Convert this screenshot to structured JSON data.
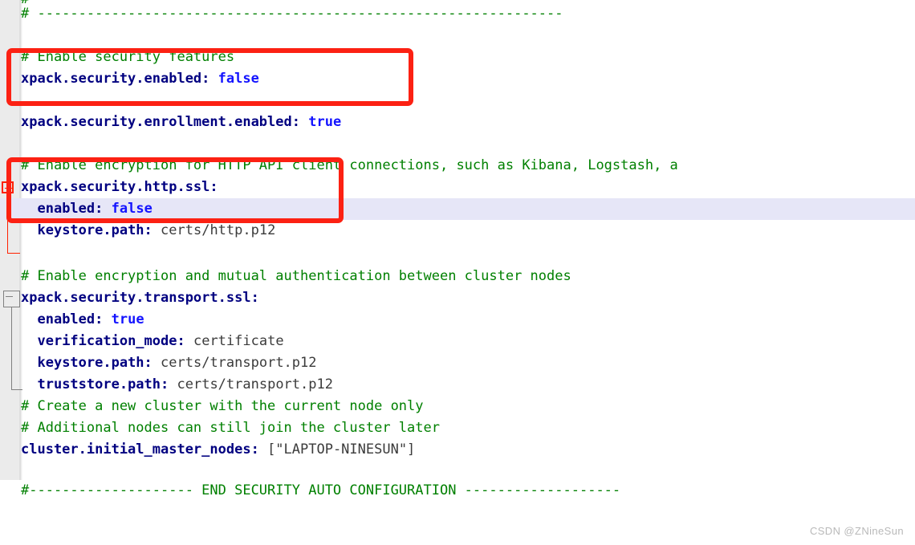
{
  "editor": {
    "gutter_color": "#ebebeb",
    "background": "#ffffff",
    "current_line_highlight": "#e6e6f7",
    "comment_color": "#008000",
    "key_color": "#000080",
    "boolean_color": "#1414ff",
    "string_color": "#3b3b3b",
    "annotation_color": "#fc2113"
  },
  "lines": [
    {
      "id": "l1",
      "indent": "",
      "comment": "#",
      "key": "",
      "value": ""
    },
    {
      "id": "l2",
      "indent": "",
      "comment": "# ----------------------------------------------------------------",
      "key": "",
      "value": ""
    },
    {
      "id": "l3",
      "indent": "",
      "comment": "",
      "key": "",
      "value": ""
    },
    {
      "id": "l4",
      "indent": "",
      "comment": "# Enable security features",
      "key": "",
      "value": ""
    },
    {
      "id": "l5",
      "indent": "",
      "comment": "",
      "key": "xpack.security.enabled:",
      "value": "false",
      "vtype": "bool"
    },
    {
      "id": "l6",
      "indent": "",
      "comment": "",
      "key": "",
      "value": ""
    },
    {
      "id": "l7",
      "indent": "",
      "comment": "",
      "key": "xpack.security.enrollment.enabled:",
      "value": "true",
      "vtype": "bool"
    },
    {
      "id": "l8",
      "indent": "",
      "comment": "",
      "key": "",
      "value": ""
    },
    {
      "id": "l9",
      "indent": "",
      "comment": "# Enable encryption for HTTP API client connections, such as Kibana, Logstash, a",
      "key": "",
      "value": ""
    },
    {
      "id": "l10",
      "indent": "",
      "comment": "",
      "key": "xpack.security.http.ssl:",
      "value": "",
      "vtype": "none"
    },
    {
      "id": "l11",
      "indent": "  ",
      "comment": "",
      "key": "enabled:",
      "value": "false",
      "vtype": "bool",
      "highlight": true
    },
    {
      "id": "l12",
      "indent": "  ",
      "comment": "",
      "key": "keystore.path:",
      "value": "certs/http.p12",
      "vtype": "str"
    },
    {
      "id": "l13",
      "indent": "",
      "comment": "",
      "key": "",
      "value": ""
    },
    {
      "id": "l14",
      "indent": "",
      "comment": "# Enable encryption and mutual authentication between cluster nodes",
      "key": "",
      "value": ""
    },
    {
      "id": "l15",
      "indent": "",
      "comment": "",
      "key": "xpack.security.transport.ssl:",
      "value": "",
      "vtype": "none"
    },
    {
      "id": "l16",
      "indent": "  ",
      "comment": "",
      "key": "enabled:",
      "value": "true",
      "vtype": "bool"
    },
    {
      "id": "l17",
      "indent": "  ",
      "comment": "",
      "key": "verification_mode:",
      "value": "certificate",
      "vtype": "str"
    },
    {
      "id": "l18",
      "indent": "  ",
      "comment": "",
      "key": "keystore.path:",
      "value": "certs/transport.p12",
      "vtype": "str"
    },
    {
      "id": "l19",
      "indent": "  ",
      "comment": "",
      "key": "truststore.path:",
      "value": "certs/transport.p12",
      "vtype": "str"
    },
    {
      "id": "l20",
      "indent": "",
      "comment": "# Create a new cluster with the current node only",
      "key": "",
      "value": ""
    },
    {
      "id": "l21",
      "indent": "",
      "comment": "# Additional nodes can still join the cluster later",
      "key": "",
      "value": ""
    },
    {
      "id": "l22",
      "indent": "",
      "comment": "",
      "key": "cluster.initial_master_nodes:",
      "value": "[\"LAPTOP-NINESUN\"]",
      "vtype": "str"
    },
    {
      "id": "l23",
      "indent": "",
      "comment": "",
      "key": "",
      "value": ""
    },
    {
      "id": "l24",
      "indent": "",
      "comment": "#-------------------- END SECURITY AUTO CONFIGURATION -------------------",
      "key": "",
      "value": ""
    }
  ],
  "fold_markers": [
    {
      "id": "fold-http-ssl",
      "style": "red",
      "label": "collapse-xpack-security-http-ssl"
    },
    {
      "id": "fold-transport-ssl",
      "style": "gray",
      "label": "collapse-xpack-security-transport-ssl"
    }
  ],
  "annotations": [
    {
      "id": "annot-security-enabled",
      "label": "xpack.security.enabled: false"
    },
    {
      "id": "annot-http-ssl-enabled",
      "label": "xpack.security.http.ssl enabled: false"
    }
  ],
  "watermark": {
    "text": "CSDN @ZNineSun"
  }
}
